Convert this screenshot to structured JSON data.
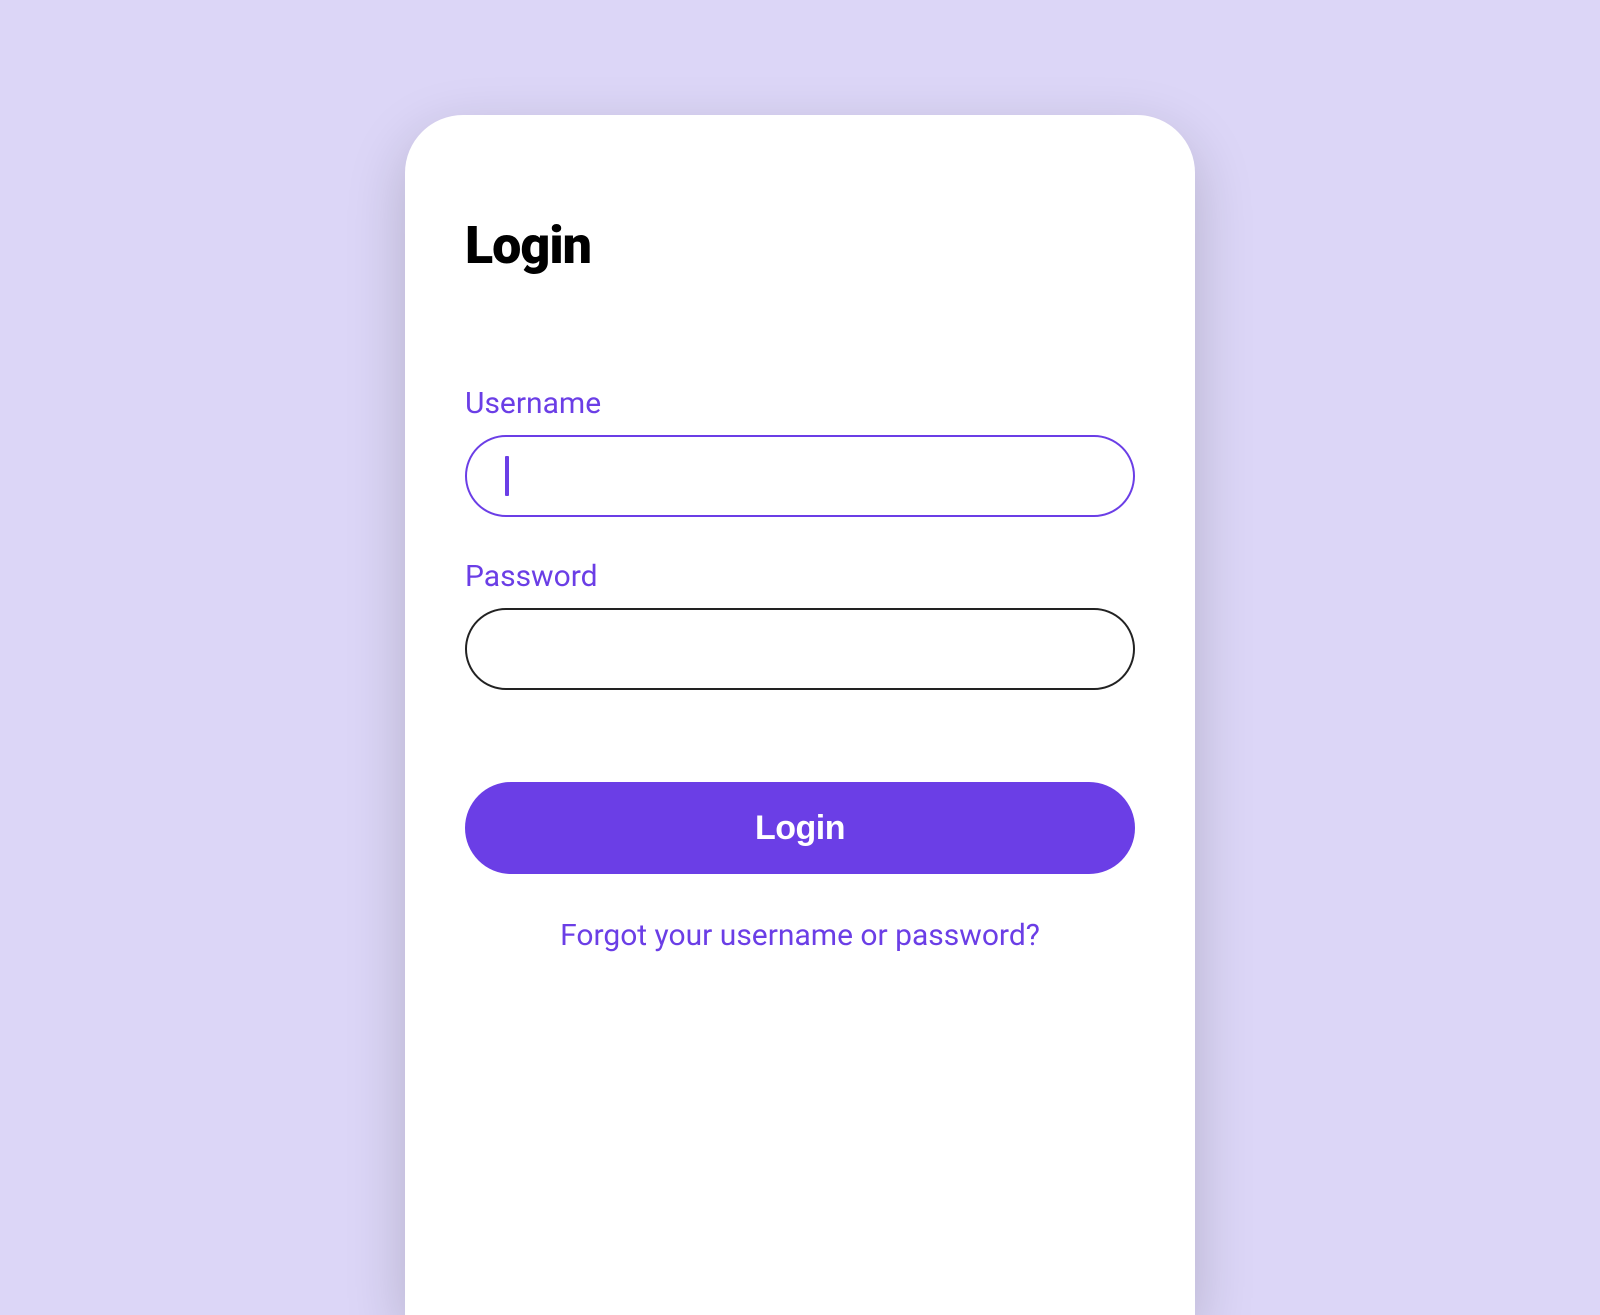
{
  "title": "Login",
  "fields": {
    "username": {
      "label": "Username",
      "value": ""
    },
    "password": {
      "label": "Password",
      "value": ""
    }
  },
  "login_button_label": "Login",
  "forgot_link_text": "Forgot your username or password?",
  "colors": {
    "accent": "#6B3EE6",
    "background": "#DCD6F7",
    "card": "#FFFFFF"
  }
}
